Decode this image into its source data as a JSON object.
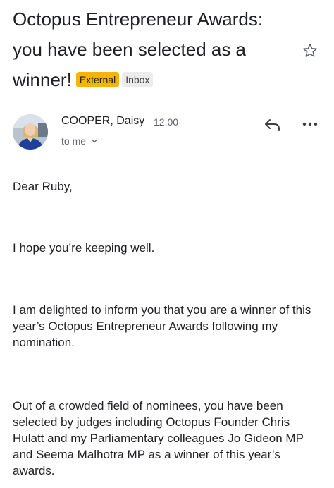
{
  "email": {
    "subject": "Octopus Entrepreneur Awards: you have been selected as a winner!",
    "labels": {
      "external": "External",
      "inbox": "Inbox"
    },
    "sender": "COOPER, Daisy",
    "time": "12:00",
    "recipient": "to me",
    "icons": [
      "star-icon",
      "reply-icon",
      "more-options-icon",
      "chevron-down-icon"
    ],
    "paragraphs": [
      "Dear Ruby,",
      "I hope you’re keeping well.",
      "I am delighted to inform you that you are a winner of this year’s Octopus Entrepreneur Awards following my nomination.",
      "Out of a crowded field of nominees, you have been selected by judges including Octopus Founder Chris Hulatt and my Parliamentary colleagues Jo Gideon MP and Seema Malhotra MP as a winner of this year’s awards."
    ]
  },
  "colors": {
    "external_badge": "#f5b400",
    "inbox_badge": "#ececec",
    "secondary_text": "#5f6368"
  }
}
